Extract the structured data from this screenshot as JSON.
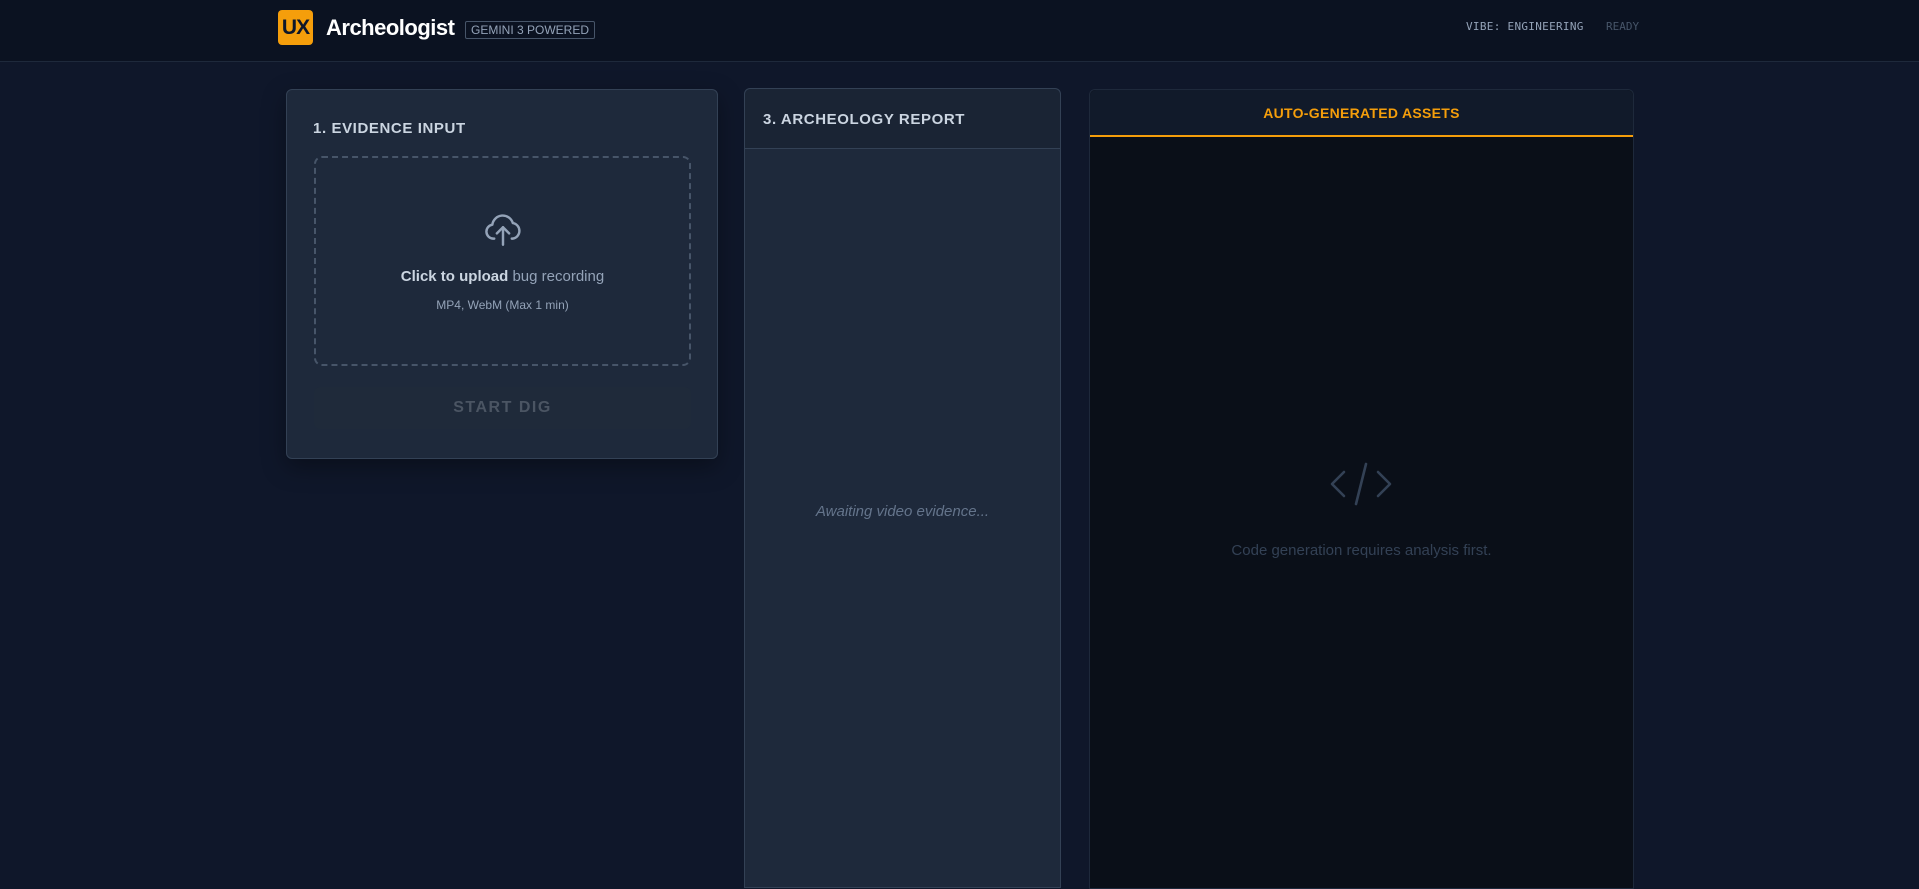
{
  "header": {
    "logo_text": "UX",
    "title": "Archeologist",
    "badge": "GEMINI 3 POWERED",
    "vibe": "VIBE: ENGINEERING",
    "status": "READY"
  },
  "evidence": {
    "heading": "1. EVIDENCE INPUT",
    "upload_strong": "Click to upload",
    "upload_rest": " bug recording",
    "formats": "MP4, WebM (Max 1 min)",
    "button": "START DIG"
  },
  "report": {
    "heading": "3. ARCHEOLOGY REPORT",
    "placeholder": "Awaiting video evidence..."
  },
  "assets": {
    "tab": "AUTO-GENERATED ASSETS",
    "empty_message": "Code generation requires analysis first."
  },
  "colors": {
    "accent": "#f59e0b",
    "background": "#0f172a",
    "panel": "#1e293b"
  },
  "icons": {
    "upload": "cloud-upload-icon",
    "code": "code-brackets-icon"
  }
}
